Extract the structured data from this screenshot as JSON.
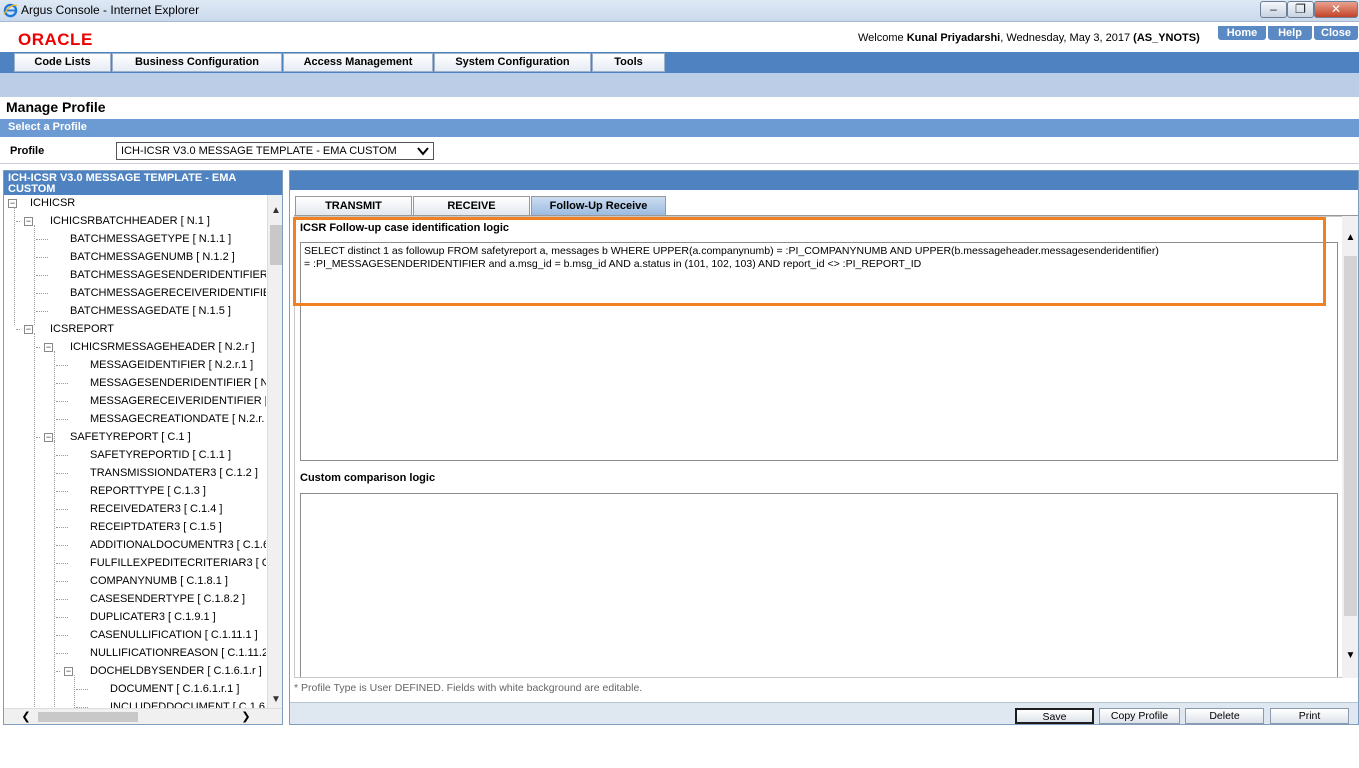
{
  "window": {
    "title": "Argus Console - Internet Explorer",
    "min": "‒",
    "max": "❐",
    "close": "✕"
  },
  "header": {
    "logo": "ORACLE",
    "welcome_prefix": "Welcome ",
    "user": "Kunal Priyadarshi",
    "date": ", Wednesday, May 3, 2017 ",
    "site": "(AS_YNOTS)",
    "links": {
      "home": "Home",
      "help": "Help",
      "close": "Close"
    }
  },
  "menu": [
    "Code Lists",
    "Business Configuration",
    "Access Management",
    "System Configuration",
    "Tools"
  ],
  "page": {
    "title": "Manage Profile",
    "select_bar": "Select a Profile",
    "profile_label": "Profile",
    "profile_value": "ICH-ICSR V3.0 MESSAGE TEMPLATE - EMA CUSTOM"
  },
  "tree": {
    "header": "ICH-ICSR V3.0 MESSAGE TEMPLATE - EMA CUSTOM",
    "nodes": [
      "ICHICSR",
      "ICHICSRBATCHHEADER [ N.1 ]",
      "BATCHMESSAGETYPE [ N.1.1 ]",
      "BATCHMESSAGENUMB [ N.1.2 ]",
      "BATCHMESSAGESENDERIDENTIFIER",
      "BATCHMESSAGERECEIVERIDENTIFIE",
      "BATCHMESSAGEDATE [ N.1.5 ]",
      "ICSREPORT",
      "ICHICSRMESSAGEHEADER [ N.2.r ]",
      "MESSAGEIDENTIFIER [ N.2.r.1 ]",
      "MESSAGESENDERIDENTIFIER [ N",
      "MESSAGERECEIVERIDENTIFIER [",
      "MESSAGECREATIONDATE [ N.2.r.",
      "SAFETYREPORT [ C.1 ]",
      "SAFETYREPORTID [ C.1.1 ]",
      "TRANSMISSIONDATER3 [ C.1.2 ]",
      "REPORTTYPE [ C.1.3 ]",
      "RECEIVEDATER3 [ C.1.4 ]",
      "RECEIPTDATER3 [ C.1.5 ]",
      "ADDITIONALDOCUMENTR3 [ C.1.6",
      "FULFILLEXPEDITECRITERIAR3 [ C",
      "COMPANYNUMB [ C.1.8.1 ]",
      "CASESENDERTYPE [ C.1.8.2 ]",
      "DUPLICATER3 [ C.1.9.1 ]",
      "CASENULLIFICATION [ C.1.11.1 ]",
      "NULLIFICATIONREASON [ C.1.11.2",
      "DOCHELDBYSENDER [ C.1.6.1.r ]",
      "DOCUMENT [ C.1.6.1.r.1 ]",
      "INCLUDEDDOCUMENT [ C.1.6.1"
    ]
  },
  "tabs": [
    "TRANSMIT",
    "RECEIVE",
    "Follow-Up Receive"
  ],
  "content": {
    "section1_label": "ICSR Follow-up case identification logic",
    "section1_text": "SELECT distinct 1 as followup FROM safetyreport a, messages b WHERE UPPER(a.companynumb) = :PI_COMPANYNUMB AND UPPER(b.messageheader.messagesenderidentifier)\n= :PI_MESSAGESENDERIDENTIFIER and a.msg_id = b.msg_id AND a.status in (101, 102, 103) AND report_id <> :PI_REPORT_ID",
    "section2_label": "Custom comparison logic",
    "section2_text": ""
  },
  "footnote": "* Profile Type is User DEFINED. Fields with white background are editable.",
  "buttons": {
    "save": "Save",
    "copy": "Copy Profile",
    "delete": "Delete",
    "print": "Print"
  },
  "colors": {
    "accent": "#4f82c0",
    "highlight": "#f08122",
    "logo": "#ee0000"
  }
}
